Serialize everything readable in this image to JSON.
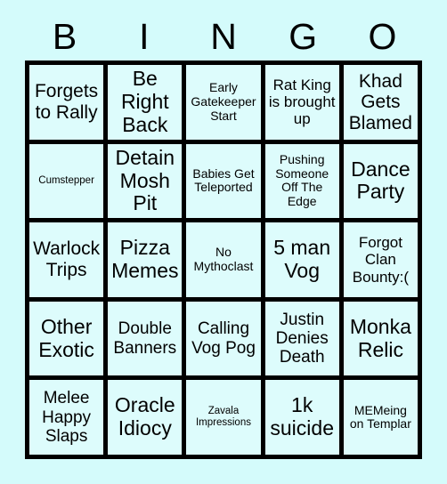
{
  "card": {
    "header_letters": [
      "B",
      "I",
      "N",
      "G",
      "O"
    ],
    "background_color": "#d4fbfb",
    "cell_color": "#ddfcfc",
    "border_color": "#000000",
    "text_color": "#000000",
    "grid_size": "5x5",
    "cells": [
      {
        "text": "Forgets to Rally",
        "size": "fs-xl"
      },
      {
        "text": "Be Right Back",
        "size": "fs-xxl"
      },
      {
        "text": "Early Gatekeeper Start",
        "size": "fs-sm"
      },
      {
        "text": "Rat King is brought up",
        "size": "fs-md"
      },
      {
        "text": "Khad Gets Blamed",
        "size": "fs-xl"
      },
      {
        "text": "Cumstepper",
        "size": "fs-xs"
      },
      {
        "text": "Detain Mosh Pit",
        "size": "fs-xxl"
      },
      {
        "text": "Babies Get Teleported",
        "size": "fs-sm"
      },
      {
        "text": "Pushing Someone Off The Edge",
        "size": "fs-sm"
      },
      {
        "text": "Dance Party",
        "size": "fs-xxl"
      },
      {
        "text": "Warlock Trips",
        "size": "fs-xl"
      },
      {
        "text": "Pizza Memes",
        "size": "fs-xxl"
      },
      {
        "text": "No Mythoclast",
        "size": "fs-sm"
      },
      {
        "text": "5 man Vog",
        "size": "fs-xxl"
      },
      {
        "text": "Forgot Clan Bounty:(",
        "size": "fs-md"
      },
      {
        "text": "Other Exotic",
        "size": "fs-xxl"
      },
      {
        "text": "Double Banners",
        "size": "fs-lg"
      },
      {
        "text": "Calling Vog Pog",
        "size": "fs-lg"
      },
      {
        "text": "Justin Denies Death",
        "size": "fs-lg"
      },
      {
        "text": "Monka Relic",
        "size": "fs-xxl"
      },
      {
        "text": "Melee Happy Slaps",
        "size": "fs-lg"
      },
      {
        "text": "Oracle Idiocy",
        "size": "fs-xxl"
      },
      {
        "text": "Zavala Impressions",
        "size": "fs-xs"
      },
      {
        "text": "1k suicide",
        "size": "fs-xxl"
      },
      {
        "text": "MEMeing on Templar",
        "size": "fs-sm"
      }
    ]
  }
}
